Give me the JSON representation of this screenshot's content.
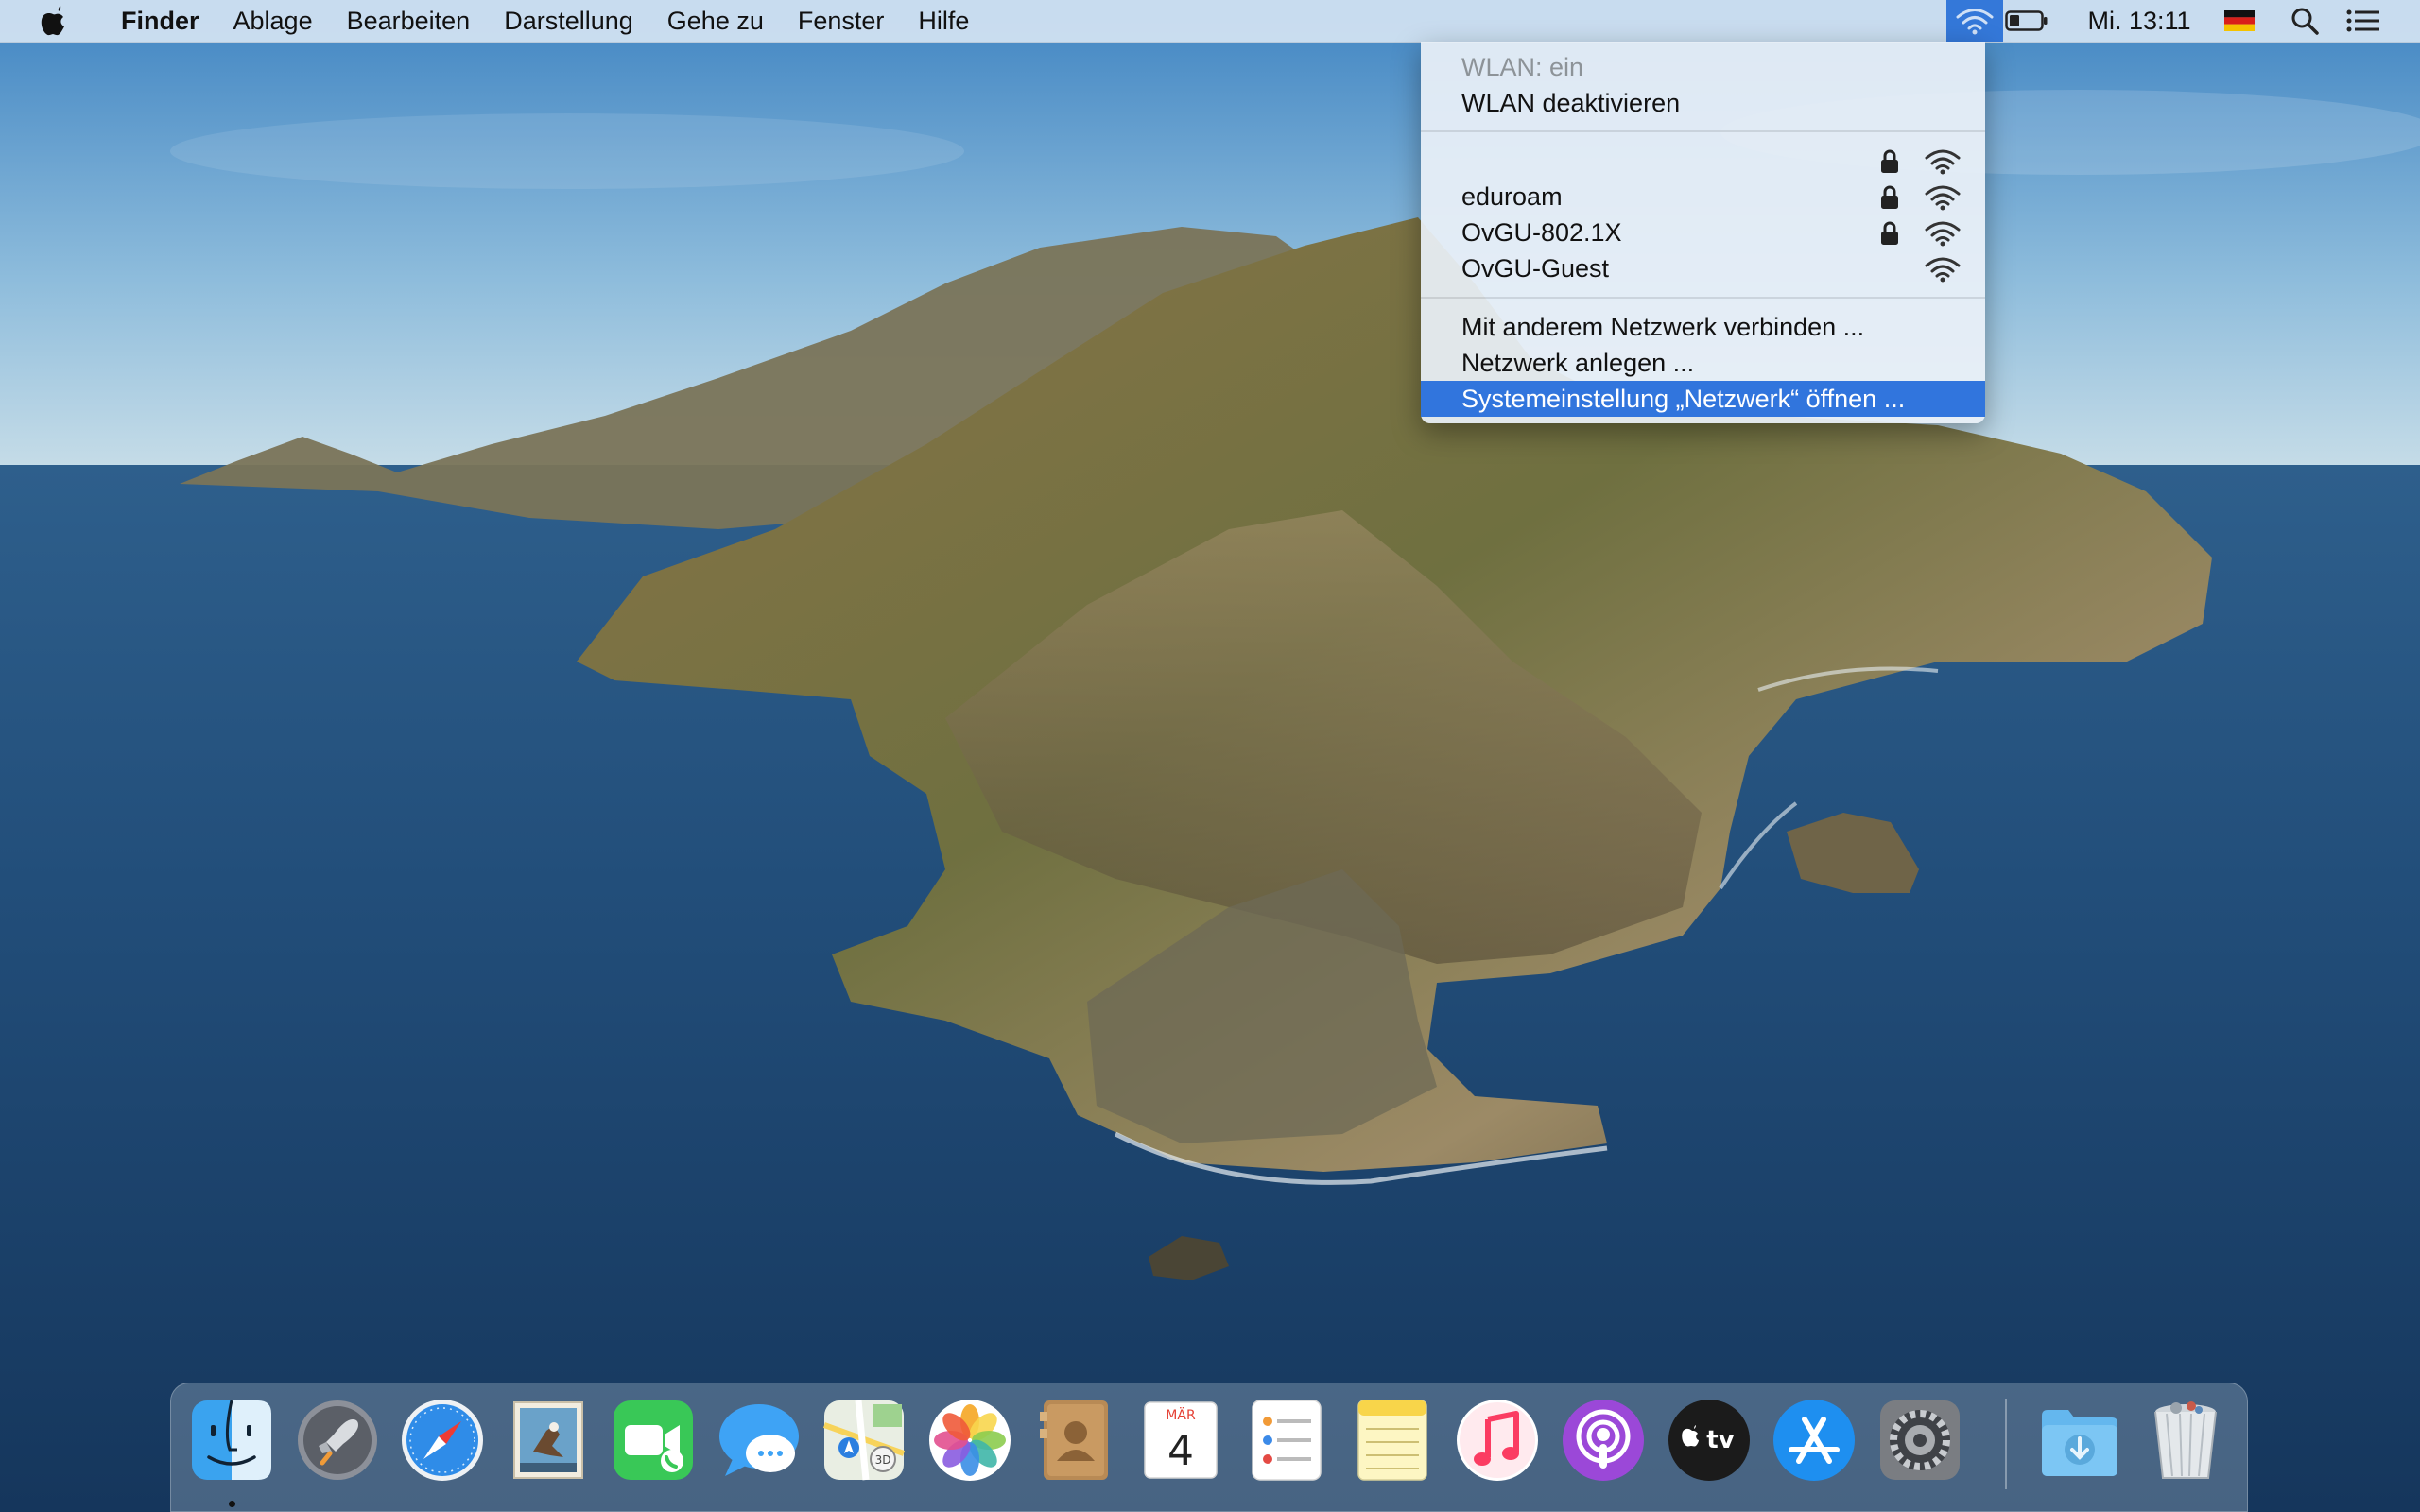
{
  "menubar": {
    "apple_icon": "apple-logo-icon",
    "app_name": "Finder",
    "items": [
      "Ablage",
      "Bearbeiten",
      "Darstellung",
      "Gehe zu",
      "Fenster",
      "Hilfe"
    ],
    "clock": "Mi. 13:11",
    "status_icons": [
      "wifi-icon",
      "battery-icon",
      "german-flag-icon",
      "spotlight-search-icon",
      "notification-center-icon"
    ],
    "accent_color": "#3175dd"
  },
  "wifi_menu": {
    "status": "WLAN: ein",
    "toggle": "WLAN deaktivieren",
    "networks": [
      {
        "name": "",
        "secured": true
      },
      {
        "name": "eduroam",
        "secured": true
      },
      {
        "name": "OvGU-802.1X",
        "secured": true
      },
      {
        "name": "OvGU-Guest",
        "secured": false
      }
    ],
    "other_network": "Mit anderem Netzwerk verbinden ...",
    "create_network": "Netzwerk anlegen ...",
    "open_prefs": "Systemeinstellung „Netzwerk“ öffnen ..."
  },
  "dock": {
    "apps": [
      "finder-icon",
      "launchpad-icon",
      "safari-icon",
      "mail-icon",
      "facetime-icon",
      "messages-icon",
      "maps-icon",
      "photos-icon",
      "contacts-icon",
      "calendar-icon",
      "reminders-icon",
      "notes-icon",
      "music-icon",
      "podcasts-icon",
      "apple-tv-icon",
      "app-store-icon",
      "system-preferences-icon",
      "downloads-folder-icon",
      "trash-icon"
    ],
    "calendar_month": "MÄR",
    "calendar_day": "4",
    "tv_label": "tv"
  }
}
